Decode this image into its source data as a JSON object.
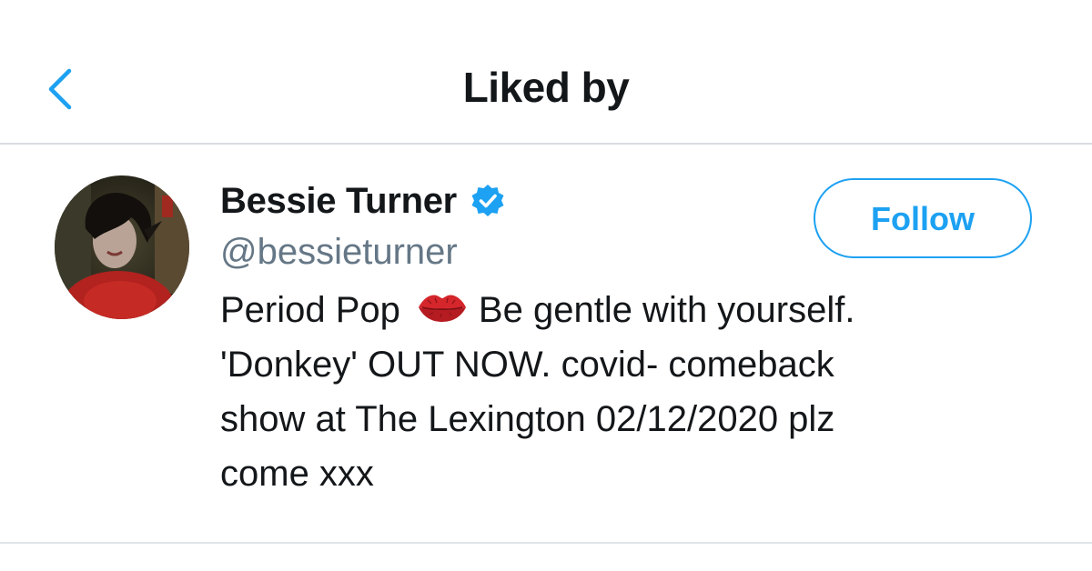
{
  "nav": {
    "title": "Liked by",
    "back_icon": "chevron-left-icon"
  },
  "colors": {
    "accent": "#1da1f2",
    "text_primary": "#14171a",
    "text_secondary": "#657786",
    "divider": "#d9dde0"
  },
  "user": {
    "display_name": "Bessie Turner",
    "verified": true,
    "verified_icon": "verified-badge-icon",
    "handle": "@bessieturner",
    "bio_lines": [
      "Period Pop",
      "Be gentle with yourself.",
      "'Donkey' OUT NOW. covid- comeback",
      "show at The Lexington 02/12/2020 plz",
      "come xxx"
    ],
    "bio_emoji": "lips-kiss-icon",
    "follow_label": "Follow"
  }
}
